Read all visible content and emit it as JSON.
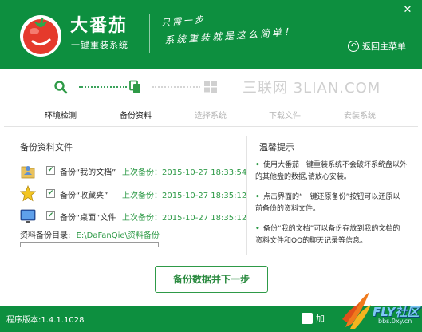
{
  "header": {
    "app_title": "大番茄",
    "app_subtitle": "一键重装系统",
    "slogan_line1": "只需一步",
    "slogan_line2": "系统重装就是这么简单！",
    "back_label": "返回主菜单",
    "minimize_symbol": "–",
    "close_symbol": "✕"
  },
  "steps": [
    {
      "label": "环境检测",
      "state": "done"
    },
    {
      "label": "备份资料",
      "state": "current"
    },
    {
      "label": "选择系统",
      "state": "pending"
    },
    {
      "label": "下载文件",
      "state": "pending"
    },
    {
      "label": "安装系统",
      "state": "pending"
    }
  ],
  "watermark": "三联网 3LIAN.COM",
  "backup": {
    "section_title": "备份资料文件",
    "items": [
      {
        "label": "备份“我的文档”",
        "checked": true,
        "time": "上次备份：2015-10-27 18:33:54",
        "icon": "documents-folder-icon"
      },
      {
        "label": "备份“收藏夹”",
        "checked": true,
        "time": "上次备份：2015-10-27 18:35:12",
        "icon": "favorites-star-icon"
      },
      {
        "label": "备份“桌面”文件",
        "checked": true,
        "time": "上次备份：2015-10-27 18:35:12",
        "icon": "desktop-monitor-icon"
      }
    ],
    "dir_label": "资料备份目录:",
    "dir_path": "E:\\DaFanQie\\资料备份",
    "progress": 0
  },
  "tips": {
    "title": "温馨提示",
    "items": [
      "使用大番茄一键重装系统不会破坏系统盘以外的其他盘的数据,请放心安装。",
      "点击界面的“一键还原备份”按钮可以还原以前备份的资料文件。",
      "备份“我的文档”可以备份存放到我的文档的资料文件和QQ的聊天记录等信息。"
    ]
  },
  "primary_button": "备份数据并下一步",
  "footer": {
    "version": "程序版本:1.4.1.1028",
    "badge_text": "加",
    "fly_brand": "FLY社区",
    "fly_url": "bbs.0xy.cn"
  },
  "colors": {
    "brand_green": "#0d8f3f",
    "accent_green": "#2e9a47",
    "tomato_red": "#e53a2c"
  }
}
